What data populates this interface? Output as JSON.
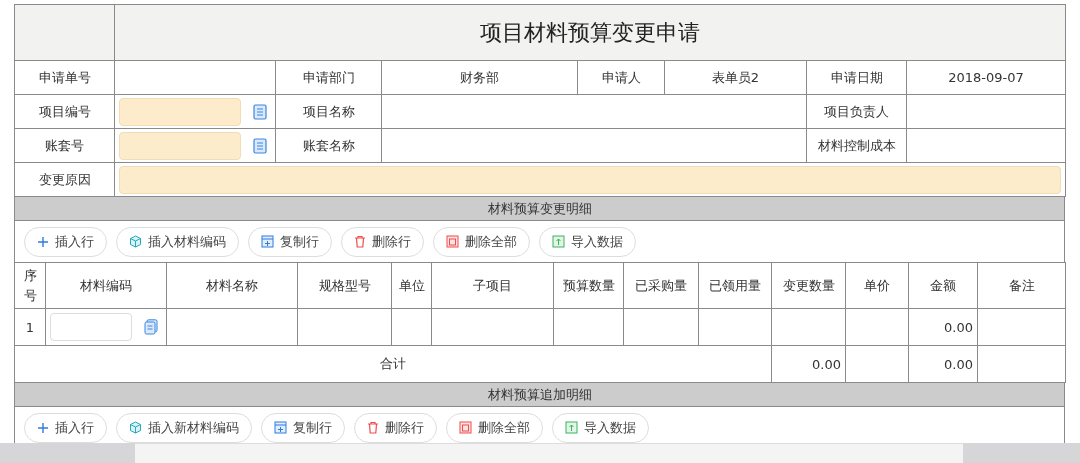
{
  "title": "项目材料预算变更申请",
  "info_rows": [
    [
      {
        "label": "申请单号",
        "kind": "text"
      },
      {
        "label": "申请部门",
        "kind": "text",
        "value": "财务部"
      },
      {
        "label": "申请人",
        "kind": "text",
        "value": "表单员2"
      },
      {
        "label": "申请日期",
        "kind": "text",
        "value": "2018-09-07"
      }
    ],
    [
      {
        "label": "项目编号",
        "kind": "input",
        "required": true
      },
      {
        "label": "项目名称",
        "kind": "text"
      },
      {
        "label": "项目负责人",
        "kind": "text"
      }
    ],
    [
      {
        "label": "账套号",
        "kind": "input",
        "required": true
      },
      {
        "label": "账套名称",
        "kind": "text"
      },
      {
        "label": "材料控制成本",
        "kind": "text"
      }
    ],
    [
      {
        "label": "变更原因",
        "kind": "wide",
        "required": true
      }
    ]
  ],
  "sections": [
    {
      "title": "材料预算变更明细",
      "toolbar": [
        {
          "label": "插入行",
          "kind": "plus"
        },
        {
          "label": "插入材料编码",
          "kind": "cube"
        },
        {
          "label": "复制行",
          "kind": "copy"
        },
        {
          "label": "删除行",
          "kind": "trash"
        },
        {
          "label": "删除全部",
          "kind": "clear"
        },
        {
          "label": "导入数据",
          "kind": "import"
        }
      ],
      "columns": [
        "序号",
        "材料编码",
        "材料名称",
        "规格型号",
        "单位",
        "子项目",
        "预算数量",
        "已采购量",
        "已领用量",
        "变更数量",
        "单价",
        "金额",
        "备注"
      ],
      "rows": [
        {
          "index": "1",
          "code_input": {
            "required": false
          },
          "amount": "0.00"
        }
      ],
      "total": {
        "label": "合计",
        "change_qty": "0.00",
        "amount": "0.00"
      }
    },
    {
      "title": "材料预算追加明细",
      "toolbar": [
        {
          "label": "插入行",
          "kind": "plus"
        },
        {
          "label": "插入新材料编码",
          "kind": "cube"
        },
        {
          "label": "复制行",
          "kind": "copy"
        },
        {
          "label": "删除行",
          "kind": "trash"
        },
        {
          "label": "删除全部",
          "kind": "clear"
        },
        {
          "label": "导入数据",
          "kind": "import"
        }
      ]
    }
  ]
}
